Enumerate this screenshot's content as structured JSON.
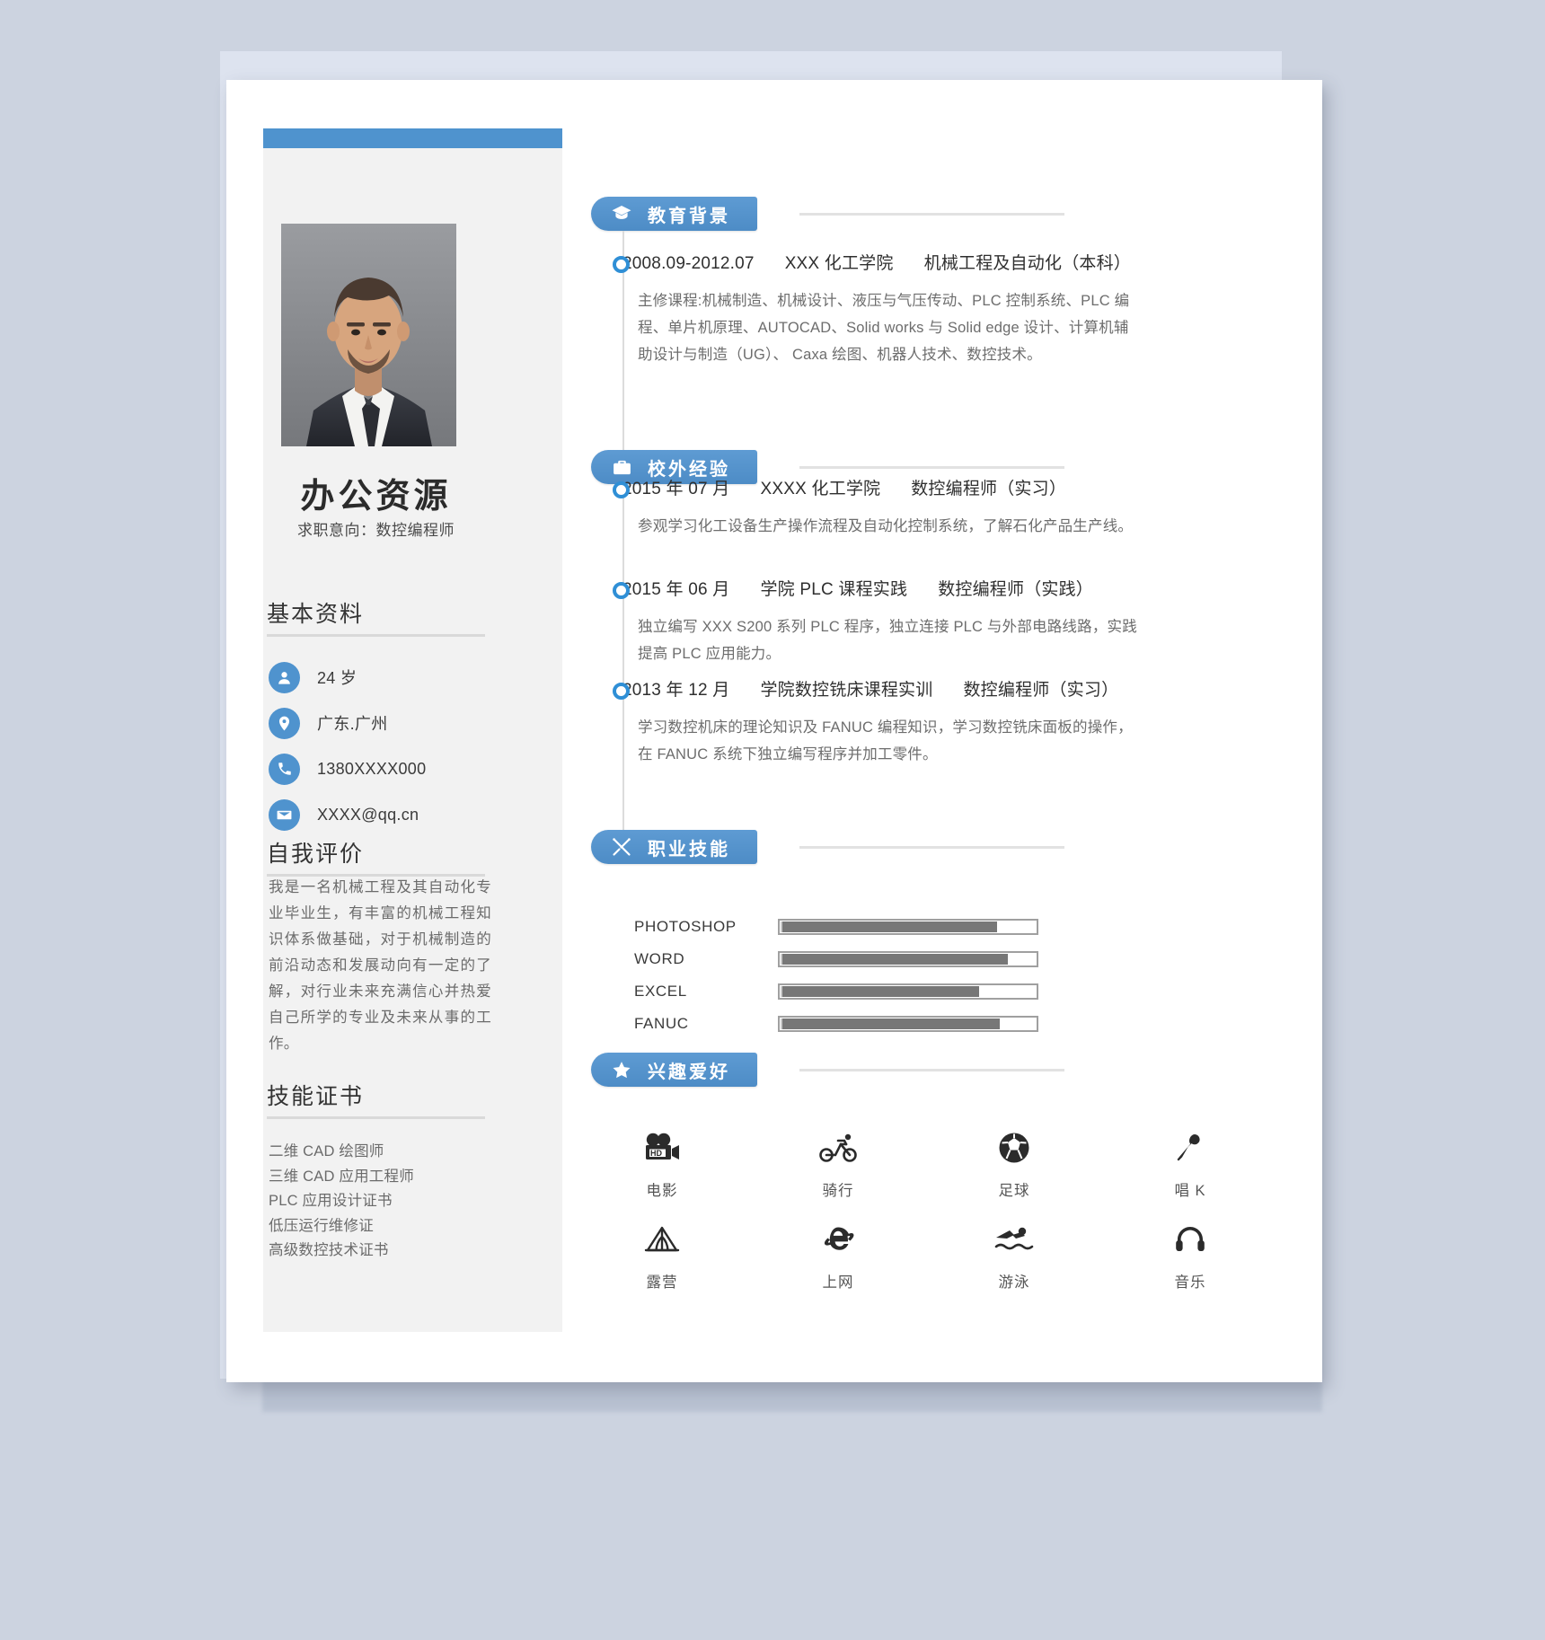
{
  "profile": {
    "name": "办公资源",
    "objective": "求职意向：数控编程师",
    "photo_alt": "证件照"
  },
  "sidebar": {
    "basic_info_title": "基本资料",
    "info_items": [
      {
        "icon": "user-icon",
        "value": "24 岁"
      },
      {
        "icon": "pin-icon",
        "value": "广东.广州"
      },
      {
        "icon": "phone-icon",
        "value": "1380XXXX000"
      },
      {
        "icon": "mail-icon",
        "value": "XXXX@qq.cn"
      }
    ],
    "self_eval_title": "自我评价",
    "self_eval_text": "我是一名机械工程及其自动化专业毕业生，有丰富的机械工程知识体系做基础，对于机械制造的前沿动态和发展动向有一定的了解，对行业未来充满信心并热爱自己所学的专业及未来从事的工作。",
    "certs_title": "技能证书",
    "certs": [
      "二维 CAD 绘图师",
      "三维 CAD 应用工程师",
      "PLC 应用设计证书",
      "低压运行维修证",
      "高级数控技术证书"
    ]
  },
  "sections": {
    "education": {
      "title": "教育背景",
      "icon": "graduation-cap-icon",
      "entries": [
        {
          "date": "2008.09-2012.07",
          "org": "XXX 化工学院",
          "role": "机械工程及自动化（本科）",
          "body": "主修课程:机械制造、机械设计、液压与气压传动、PLC 控制系统、PLC 编程、单片机原理、AUTOCAD、Solid works 与 Solid edge 设计、计算机辅助设计与制造（UG）、 Caxa 绘图、机器人技术、数控技术。"
        }
      ]
    },
    "experience": {
      "title": "校外经验",
      "icon": "briefcase-icon",
      "entries": [
        {
          "date": "2015 年 07 月",
          "org": "XXXX 化工学院",
          "role": "数控编程师（实习）",
          "body": "参观学习化工设备生产操作流程及自动化控制系统，了解石化产品生产线。"
        },
        {
          "date": "2015 年 06 月",
          "org": "学院 PLC 课程实践",
          "role": "数控编程师（实践）",
          "body": "独立编写 XXX S200 系列 PLC 程序，独立连接 PLC 与外部电路线路，实践提高 PLC 应用能力。"
        },
        {
          "date": "2013 年 12 月",
          "org": "学院数控铣床课程实训",
          "role": "数控编程师（实习）",
          "body": "学习数控机床的理论知识及 FANUC 编程知识，学习数控铣床面板的操作，在 FANUC 系统下独立编写程序并加工零件。"
        }
      ]
    },
    "skills": {
      "title": "职业技能",
      "icon": "tools-icon",
      "items": [
        {
          "name": "PHOTOSHOP",
          "percent": 85
        },
        {
          "name": "WORD",
          "percent": 89
        },
        {
          "name": "EXCEL",
          "percent": 78
        },
        {
          "name": "FANUC",
          "percent": 86
        }
      ]
    },
    "hobbies": {
      "title": "兴趣爱好",
      "icon": "star-icon",
      "items": [
        {
          "icon": "movie-camera-icon",
          "label": "电影"
        },
        {
          "icon": "cycling-icon",
          "label": "骑行"
        },
        {
          "icon": "soccer-ball-icon",
          "label": "足球"
        },
        {
          "icon": "microphone-icon",
          "label": "唱 K"
        },
        {
          "icon": "tent-icon",
          "label": "露营"
        },
        {
          "icon": "internet-explorer-icon",
          "label": "上网"
        },
        {
          "icon": "swimming-icon",
          "label": "游泳"
        },
        {
          "icon": "headphones-icon",
          "label": "音乐"
        }
      ]
    }
  },
  "colors": {
    "accent": "#4f93ce",
    "pill_dark": "#4d8cc6",
    "page_bg": "#ffffff",
    "sidebar_bg": "#f2f2f2",
    "canvas_bg": "#ccd3e0",
    "bar_fill": "#777777",
    "rule": "#e2e2e2"
  }
}
